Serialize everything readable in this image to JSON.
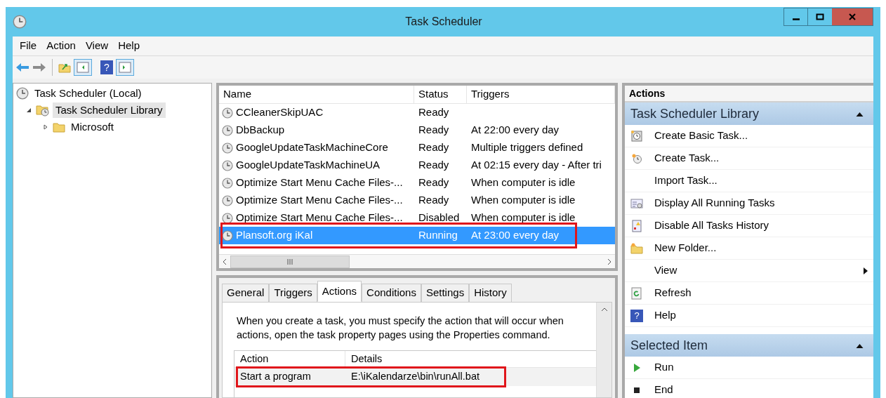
{
  "window": {
    "title": "Task Scheduler"
  },
  "menu": [
    "File",
    "Action",
    "View",
    "Help"
  ],
  "toolbar": {
    "help_glyph": "?"
  },
  "tree": [
    {
      "label": "Task Scheduler (Local)",
      "kind": "root",
      "selected": false,
      "children": [
        {
          "label": "Task Scheduler Library",
          "kind": "library",
          "selected": true,
          "expanded": true,
          "children": [
            {
              "label": "Microsoft",
              "kind": "folder",
              "selected": false,
              "expanded": false
            }
          ]
        }
      ]
    }
  ],
  "task_table": {
    "columns": [
      "Name",
      "Status",
      "Triggers"
    ],
    "rows": [
      {
        "name": "CCleanerSkipUAC",
        "status": "Ready",
        "triggers": "",
        "selected": false
      },
      {
        "name": "DbBackup",
        "status": "Ready",
        "triggers": "At 22:00 every day",
        "selected": false
      },
      {
        "name": "GoogleUpdateTaskMachineCore",
        "status": "Ready",
        "triggers": "Multiple triggers defined",
        "selected": false
      },
      {
        "name": "GoogleUpdateTaskMachineUA",
        "status": "Ready",
        "triggers": "At 02:15 every day - After tri",
        "selected": false
      },
      {
        "name": "Optimize Start Menu Cache Files-...",
        "status": "Ready",
        "triggers": "When computer is idle",
        "selected": false
      },
      {
        "name": "Optimize Start Menu Cache Files-...",
        "status": "Ready",
        "triggers": "When computer is idle",
        "selected": false
      },
      {
        "name": "Optimize Start Menu Cache Files-...",
        "status": "Disabled",
        "triggers": "When computer is idle",
        "selected": false
      },
      {
        "name": "Plansoft.org iKal",
        "status": "Running",
        "triggers": "At 23:00 every day",
        "selected": true
      }
    ]
  },
  "detail_tabs": [
    {
      "label": "General",
      "selected": false
    },
    {
      "label": "Triggers",
      "selected": false
    },
    {
      "label": "Actions",
      "selected": true
    },
    {
      "label": "Conditions",
      "selected": false
    },
    {
      "label": "Settings",
      "selected": false
    },
    {
      "label": "History",
      "selected": false
    }
  ],
  "detail": {
    "description": [
      "When you create a task, you must specify the action that will occur when",
      "actions, open the task property pages using the Properties command."
    ],
    "columns": [
      "Action",
      "Details"
    ],
    "rows": [
      {
        "action": "Start a program",
        "details": "E:\\iKalendarze\\bin\\runAll.bat"
      }
    ]
  },
  "actions_pane": {
    "title": "Actions",
    "sections": [
      {
        "title": "Task Scheduler Library",
        "expanded": true,
        "items": [
          {
            "label": "Create Basic Task...",
            "kind": "basic"
          },
          {
            "label": "Create Task...",
            "kind": "create"
          },
          {
            "label": "Import Task...",
            "kind": "none"
          },
          {
            "label": "Display All Running Tasks",
            "kind": "running"
          },
          {
            "label": "Disable All Tasks History",
            "kind": "history"
          },
          {
            "label": "New Folder...",
            "kind": "folder"
          },
          {
            "label": "View",
            "kind": "submenu"
          },
          {
            "label": "Refresh",
            "kind": "refresh"
          },
          {
            "label": "Help",
            "kind": "help",
            "glyph": "?"
          }
        ]
      },
      {
        "title": "Selected Item",
        "expanded": true,
        "items": [
          {
            "label": "Run",
            "kind": "run"
          },
          {
            "label": "End",
            "kind": "end"
          }
        ]
      }
    ]
  }
}
